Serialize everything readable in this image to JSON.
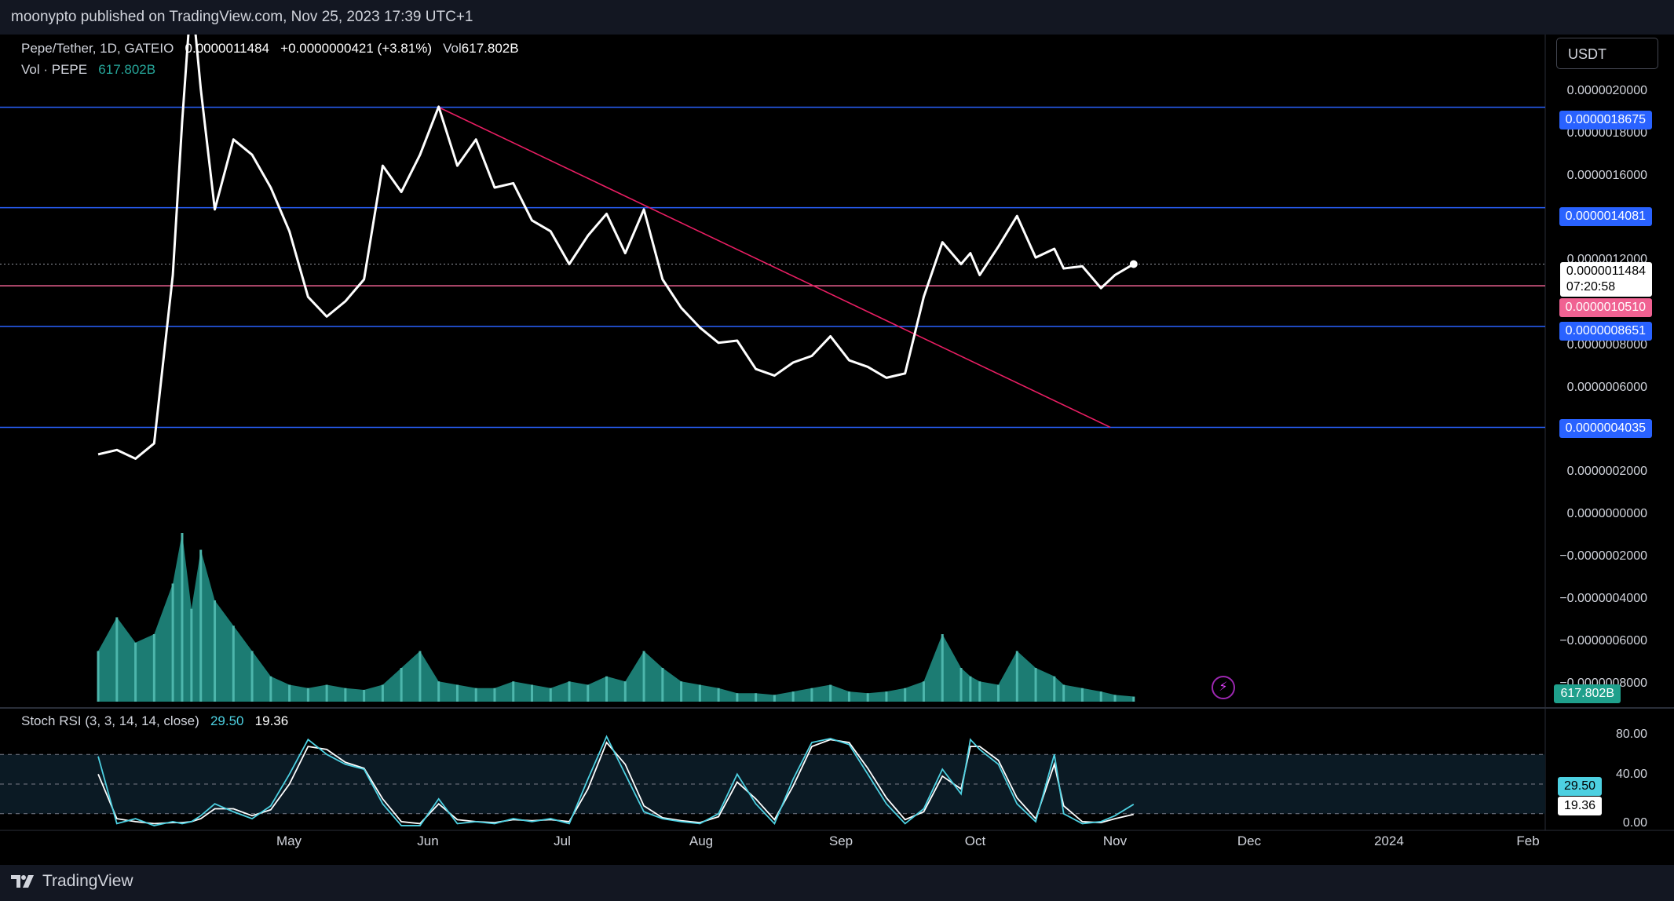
{
  "header": {
    "publisher_line": "moonypto published on TradingView.com, Nov 25, 2023 17:39 UTC+1"
  },
  "legend": {
    "symbol": "Pepe/Tether, 1D, GATEIO",
    "price": "0.0000011484",
    "change": "+0.0000000421 (+3.81%)",
    "vol_label": "Vol",
    "vol_value": "617.802B",
    "vol_series": "Vol · PEPE",
    "vol_series_value": "617.802B"
  },
  "currency_button": "USDT",
  "price_axis_ticks": [
    "0.0000020000",
    "0.0000018000",
    "0.0000016000",
    "0.0000012000",
    "0.0000008000",
    "0.0000006000",
    "0.0000002000",
    "0.0000000000",
    "−0.0000002000",
    "−0.0000004000",
    "−0.0000006000",
    "−0.0000008000"
  ],
  "price_labels": {
    "level_1": "0.0000018675",
    "level_2": "0.0000014081",
    "current_price": "0.0000011484",
    "countdown": "07:20:58",
    "red_level": "0.0000010510",
    "level_3": "0.0000008651",
    "level_4": "0.0000004035",
    "volume": "617.802B"
  },
  "stoch": {
    "label": "Stoch RSI (3, 3, 14, 14, close)",
    "k_value": "29.50",
    "d_value": "19.36",
    "axis_80": "80.00",
    "axis_40": "40.00",
    "axis_0": "0.00"
  },
  "x_axis": [
    "May",
    "Jun",
    "Jul",
    "Aug",
    "Sep",
    "Oct",
    "Nov",
    "Dec",
    "2024",
    "Feb"
  ],
  "brand": "TradingView",
  "colors": {
    "price_line": "#ffffff",
    "horizontal_levels": "#2962ff",
    "trendline": "#e91e63",
    "red_level": "#f06292",
    "volume": "#26a69a",
    "stoch_k": "#4dd0e1",
    "stoch_d": "#ffffff"
  },
  "chart_data": {
    "type": "line",
    "title": "Pepe/Tether, 1D, GATEIO",
    "x_dates": [
      "2023-04-17",
      "2023-04-21",
      "2023-04-25",
      "2023-04-29",
      "2023-05-03",
      "2023-05-05",
      "2023-05-07",
      "2023-05-09",
      "2023-05-12",
      "2023-05-16",
      "2023-05-20",
      "2023-05-24",
      "2023-05-28",
      "2023-06-01",
      "2023-06-05",
      "2023-06-09",
      "2023-06-13",
      "2023-06-17",
      "2023-06-21",
      "2023-06-25",
      "2023-06-29",
      "2023-07-03",
      "2023-07-07",
      "2023-07-11",
      "2023-07-15",
      "2023-07-19",
      "2023-07-23",
      "2023-07-27",
      "2023-07-31",
      "2023-08-04",
      "2023-08-08",
      "2023-08-12",
      "2023-08-16",
      "2023-08-20",
      "2023-08-24",
      "2023-08-28",
      "2023-09-01",
      "2023-09-05",
      "2023-09-09",
      "2023-09-13",
      "2023-09-17",
      "2023-09-21",
      "2023-09-25",
      "2023-09-29",
      "2023-10-03",
      "2023-10-07",
      "2023-10-11",
      "2023-10-15",
      "2023-10-19",
      "2023-10-21",
      "2023-10-23",
      "2023-10-27",
      "2023-10-31",
      "2023-11-04",
      "2023-11-08",
      "2023-11-10",
      "2023-11-14",
      "2023-11-18",
      "2023-11-21",
      "2023-11-25"
    ],
    "close_values": [
      2.8e-07,
      3e-07,
      2.6e-07,
      3.3e-07,
      1.1e-06,
      1.8e-06,
      2.4e-06,
      1.95e-06,
      1.4e-06,
      1.72e-06,
      1.65e-06,
      1.5e-06,
      1.3e-06,
      1e-06,
      9.1e-07,
      9.8e-07,
      1.08e-06,
      1.6e-06,
      1.48e-06,
      1.65e-06,
      1.87e-06,
      1.6e-06,
      1.72e-06,
      1.5e-06,
      1.52e-06,
      1.35e-06,
      1.3e-06,
      1.15e-06,
      1.28e-06,
      1.38e-06,
      1.2e-06,
      1.4e-06,
      1.08e-06,
      9.5e-07,
      8.6e-07,
      7.9e-07,
      8e-07,
      6.7e-07,
      6.4e-07,
      7e-07,
      7.3e-07,
      8.2e-07,
      7.1e-07,
      6.8e-07,
      6.3e-07,
      6.5e-07,
      1e-06,
      1.25e-06,
      1.15e-06,
      1.2e-06,
      1.1e-06,
      1.23e-06,
      1.37e-06,
      1.18e-06,
      1.22e-06,
      1.13e-06,
      1.14e-06,
      1.04e-06,
      1.1e-06,
      1.15e-06
    ],
    "horizontal_levels": [
      1.8675e-06,
      1.4081e-06,
      8.651e-07,
      4.035e-07
    ],
    "red_level": 1.051e-06,
    "trendline": {
      "from": [
        "2023-06-29",
        1.8675e-06
      ],
      "to": [
        "2023-11-20",
        4.035e-07
      ]
    },
    "volume_relative": [
      0.3,
      0.5,
      0.35,
      0.4,
      0.7,
      1.0,
      0.55,
      0.9,
      0.6,
      0.45,
      0.3,
      0.15,
      0.1,
      0.08,
      0.1,
      0.08,
      0.07,
      0.1,
      0.2,
      0.3,
      0.12,
      0.1,
      0.08,
      0.08,
      0.12,
      0.1,
      0.08,
      0.12,
      0.1,
      0.15,
      0.12,
      0.3,
      0.2,
      0.12,
      0.1,
      0.08,
      0.05,
      0.05,
      0.04,
      0.06,
      0.08,
      0.1,
      0.06,
      0.05,
      0.06,
      0.08,
      0.12,
      0.4,
      0.2,
      0.15,
      0.12,
      0.1,
      0.3,
      0.2,
      0.15,
      0.1,
      0.08,
      0.06,
      0.04,
      0.03
    ],
    "stoch_k": [
      78,
      10,
      15,
      8,
      12,
      10,
      12,
      18,
      30,
      22,
      15,
      28,
      60,
      95,
      80,
      70,
      65,
      30,
      8,
      8,
      35,
      10,
      12,
      10,
      15,
      12,
      15,
      10,
      55,
      98,
      60,
      22,
      15,
      12,
      10,
      20,
      60,
      30,
      10,
      55,
      92,
      96,
      90,
      60,
      30,
      10,
      25,
      65,
      40,
      95,
      85,
      70,
      30,
      12,
      80,
      20,
      10,
      12,
      18,
      29.5
    ],
    "stoch_d": [
      60,
      15,
      12,
      10,
      11,
      11,
      12,
      15,
      25,
      25,
      18,
      24,
      50,
      88,
      85,
      72,
      66,
      35,
      12,
      10,
      30,
      14,
      12,
      11,
      14,
      13,
      14,
      12,
      45,
      92,
      70,
      28,
      16,
      13,
      11,
      17,
      52,
      35,
      14,
      48,
      88,
      95,
      92,
      66,
      36,
      14,
      22,
      58,
      45,
      88,
      88,
      74,
      36,
      15,
      70,
      28,
      12,
      11,
      15,
      19.36
    ],
    "price_ylim": [
      -8.8e-07,
      2.2e-06
    ],
    "stoch_ylim": [
      0,
      100
    ],
    "stoch_bands": [
      20,
      50,
      80
    ]
  }
}
